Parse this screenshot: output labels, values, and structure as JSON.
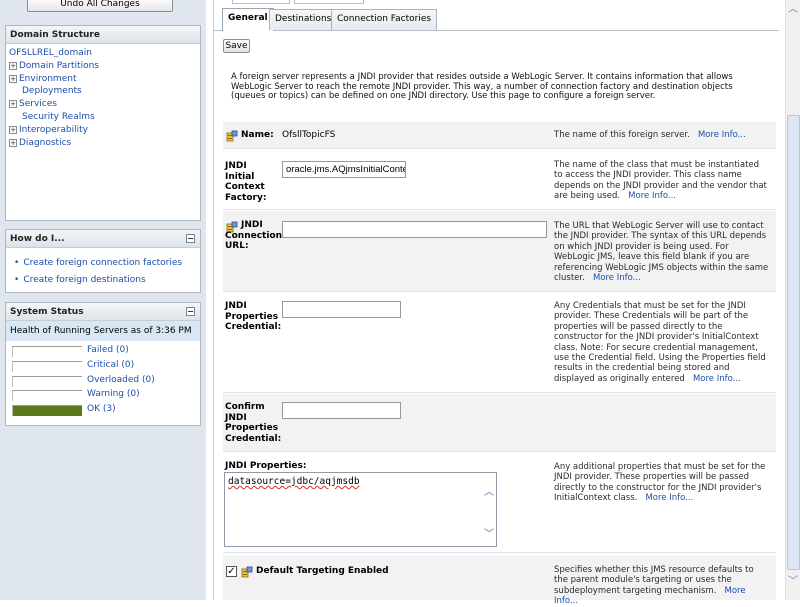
{
  "left": {
    "undo_label": "Undo All Changes",
    "domain_structure": {
      "title": "Domain Structure",
      "items": [
        {
          "label": "OFSLLREL_domain",
          "toggle": ""
        },
        {
          "label": "Domain Partitions",
          "toggle": "+"
        },
        {
          "label": "Environment",
          "toggle": "+"
        },
        {
          "label": "Deployments",
          "toggle": ""
        },
        {
          "label": "Services",
          "toggle": "+"
        },
        {
          "label": "Security Realms",
          "toggle": ""
        },
        {
          "label": "Interoperability",
          "toggle": "+"
        },
        {
          "label": "Diagnostics",
          "toggle": "+"
        }
      ]
    },
    "how_do_i": {
      "title": "How do I...",
      "items": [
        "Create foreign connection factories",
        "Create foreign destinations"
      ]
    },
    "system_status": {
      "title": "System Status",
      "health_text": "Health of Running Servers as of  3:36 PM",
      "rows": [
        {
          "label": "Failed (0)",
          "fill": 0,
          "color": "#b00000"
        },
        {
          "label": "Critical (0)",
          "fill": 0,
          "color": "#e03030"
        },
        {
          "label": "Overloaded (0)",
          "fill": 0,
          "color": "#e08000"
        },
        {
          "label": "Warning (0)",
          "fill": 0,
          "color": "#e0c000"
        },
        {
          "label": "OK (3)",
          "fill": 1,
          "color": "#5a7a1a"
        }
      ]
    }
  },
  "main": {
    "tabs": [
      "General",
      "Destinations",
      "Connection Factories"
    ],
    "active_tab": "General",
    "save_label": "Save",
    "intro": "A foreign server represents a JNDI provider that resides outside a WebLogic Server. It contains information that allows WebLogic Server to reach the remote JNDI provider. This way, a number of connection factory and destination objects (queues or topics) can be defined on one JNDI directory. Use this page to configure a foreign server.",
    "more_info": "More Info...",
    "fields": {
      "name": {
        "label": "Name:",
        "value": "OfsllTopicFS",
        "desc": "The name of this foreign server."
      },
      "jndi_factory": {
        "label": "JNDI Initial Context Factory:",
        "label_lines": [
          "JNDI",
          "Initial",
          "Context",
          "Factory:"
        ],
        "value": "oracle.jms.AQjmsInitialContextFactory",
        "desc": "The name of the class that must be instantiated to access the JNDI provider. This class name depends on the JNDI provider and the vendor that are being used."
      },
      "jndi_url": {
        "label_lines": [
          "JNDI",
          "Connection",
          "URL:"
        ],
        "value": "",
        "desc": "The URL that WebLogic Server will use to contact the JNDI provider. The syntax of this URL depends on which JNDI provider is being used. For WebLogic JMS, leave this field blank if you are referencing WebLogic JMS objects within the same cluster."
      },
      "jndi_credential": {
        "label_lines": [
          "JNDI",
          "Properties",
          "Credential:"
        ],
        "value": "",
        "desc": "Any Credentials that must be set for the JNDI provider. These Credentials will be part of the properties will be passed directly to the constructor for the JNDI provider's InitialContext class. Note: For secure credential management, use the Credential field. Using the Properties field results in the credential being stored and displayed as originally entered"
      },
      "confirm_credential": {
        "label_lines": [
          "Confirm",
          "JNDI",
          "Properties",
          "Credential:"
        ],
        "value": ""
      },
      "jndi_properties": {
        "label": "JNDI Properties:",
        "value": "datasource=jdbc/aqjmsdb",
        "desc": "Any additional properties that must be set for the JNDI provider. These properties will be passed directly to the constructor for the JNDI provider's InitialContext class."
      },
      "default_targeting": {
        "label": "Default Targeting Enabled",
        "checked": true,
        "desc": "Specifies whether this JMS resource defaults to the parent module's targeting or uses the subdeployment targeting mechanism."
      }
    }
  }
}
